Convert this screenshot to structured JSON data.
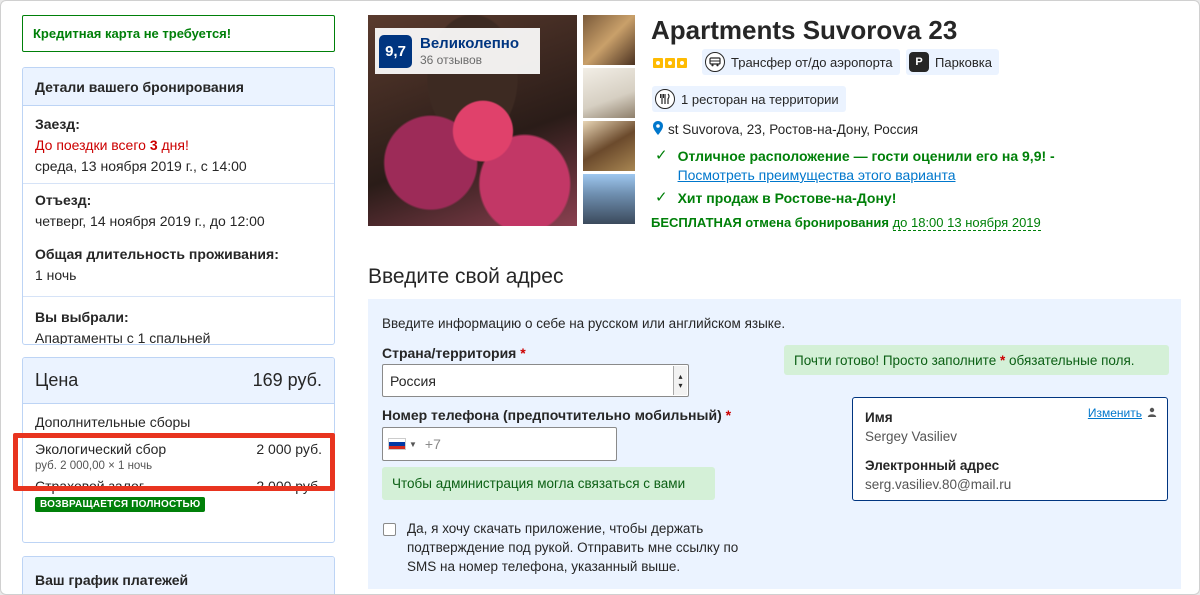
{
  "left": {
    "notice": "Кредитная карта не требуется!",
    "details": {
      "title": "Детали вашего бронирования",
      "checkin_label": "Заезд:",
      "checkin_countdown_prefix": "До поездки всего ",
      "checkin_countdown_days": "3",
      "checkin_countdown_suffix": " дня!",
      "checkin_date": "среда, 13 ноября 2019 г., с 14:00",
      "checkout_label": "Отъезд:",
      "checkout_date": "четверг, 14 ноября 2019 г., до 12:00",
      "duration_label": "Общая длительность проживания:",
      "duration_value": "1 ночь",
      "chosen_label": "Вы выбрали:",
      "chosen_value": "Апартаменты с 1 спальней"
    },
    "price": {
      "title": "Цена",
      "total": "169 руб.",
      "fees_label": "Дополнительные сборы",
      "eco_label": "Экологический сбор",
      "eco_value": "2 000 руб.",
      "eco_calc": "руб. 2 000,00  ×  1 ночь",
      "deposit_label": "Страховой залог",
      "deposit_value": "2 000 руб.",
      "deposit_badge": "ВОЗВРАЩАЕТСЯ ПОЛНОСТЬЮ"
    },
    "schedule": {
      "title": "Ваш график платежей"
    }
  },
  "hotel": {
    "score": "9,7",
    "score_word": "Великолепно",
    "reviews": "36 отзывов",
    "name": "Apartments Suvorova 23",
    "stars": 3,
    "amenities": [
      {
        "icon": "shuttle-icon",
        "label": "Трансфер от/до аэропорта"
      },
      {
        "icon": "parking-icon",
        "glyph": "P",
        "label": "Парковка"
      },
      {
        "icon": "restaurant-icon",
        "label": "1 ресторан на территории"
      }
    ],
    "address": "st Suvorova, 23, Ростов-на-Дону, Россия",
    "highlight1": "Отличное расположение — гости оценили его на 9,9! -",
    "highlight1_link": "Посмотреть преимущества этого варианта",
    "highlight2": "Хит продаж в Ростове-на-Дону!",
    "cancel_bold": "БЕСПЛАТНАЯ отмена бронирования",
    "cancel_until": "до 18:00 13 ноября 2019"
  },
  "form": {
    "title": "Введите свой адрес",
    "intro": "Введите информацию о себе на русском или английском языке.",
    "country_label": "Страна/территория",
    "required_mark": "*",
    "country_value": "Россия",
    "phone_label": "Номер телефона (предпочтительно мобильный)",
    "phone_placeholder": "+7",
    "phone_tip": "Чтобы администрация могла связаться с вами",
    "almost_prefix": "Почти готово! Просто заполните ",
    "almost_star": "*",
    "almost_suffix": " обязательные поля.",
    "consent": "Да, я хочу скачать приложение, чтобы держать подтверждение под рукой. Отправить мне ссылку по SMS на номер телефона, указанный выше.",
    "profile": {
      "name_label": "Имя",
      "name_value": "Sergey Vasiliev",
      "email_label": "Электронный адрес",
      "email_value": "serg.vasiliev.80@mail.ru",
      "change": "Изменить"
    }
  },
  "colors": {
    "brand_blue": "#003580",
    "link_blue": "#0077cc",
    "green": "#008009",
    "highlight_red": "#e8341f",
    "star_yellow": "#febb02"
  }
}
